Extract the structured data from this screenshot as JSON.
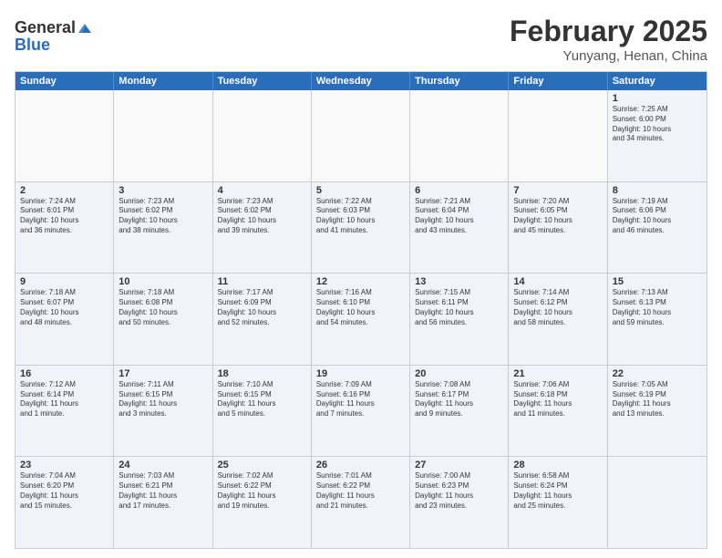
{
  "header": {
    "logo_general": "General",
    "logo_blue": "Blue",
    "month": "February 2025",
    "location": "Yunyang, Henan, China"
  },
  "weekdays": [
    "Sunday",
    "Monday",
    "Tuesday",
    "Wednesday",
    "Thursday",
    "Friday",
    "Saturday"
  ],
  "rows": [
    [
      {
        "day": "",
        "text": ""
      },
      {
        "day": "",
        "text": ""
      },
      {
        "day": "",
        "text": ""
      },
      {
        "day": "",
        "text": ""
      },
      {
        "day": "",
        "text": ""
      },
      {
        "day": "",
        "text": ""
      },
      {
        "day": "1",
        "text": "Sunrise: 7:25 AM\nSunset: 6:00 PM\nDaylight: 10 hours\nand 34 minutes."
      }
    ],
    [
      {
        "day": "2",
        "text": "Sunrise: 7:24 AM\nSunset: 6:01 PM\nDaylight: 10 hours\nand 36 minutes."
      },
      {
        "day": "3",
        "text": "Sunrise: 7:23 AM\nSunset: 6:02 PM\nDaylight: 10 hours\nand 38 minutes."
      },
      {
        "day": "4",
        "text": "Sunrise: 7:23 AM\nSunset: 6:02 PM\nDaylight: 10 hours\nand 39 minutes."
      },
      {
        "day": "5",
        "text": "Sunrise: 7:22 AM\nSunset: 6:03 PM\nDaylight: 10 hours\nand 41 minutes."
      },
      {
        "day": "6",
        "text": "Sunrise: 7:21 AM\nSunset: 6:04 PM\nDaylight: 10 hours\nand 43 minutes."
      },
      {
        "day": "7",
        "text": "Sunrise: 7:20 AM\nSunset: 6:05 PM\nDaylight: 10 hours\nand 45 minutes."
      },
      {
        "day": "8",
        "text": "Sunrise: 7:19 AM\nSunset: 6:06 PM\nDaylight: 10 hours\nand 46 minutes."
      }
    ],
    [
      {
        "day": "9",
        "text": "Sunrise: 7:18 AM\nSunset: 6:07 PM\nDaylight: 10 hours\nand 48 minutes."
      },
      {
        "day": "10",
        "text": "Sunrise: 7:18 AM\nSunset: 6:08 PM\nDaylight: 10 hours\nand 50 minutes."
      },
      {
        "day": "11",
        "text": "Sunrise: 7:17 AM\nSunset: 6:09 PM\nDaylight: 10 hours\nand 52 minutes."
      },
      {
        "day": "12",
        "text": "Sunrise: 7:16 AM\nSunset: 6:10 PM\nDaylight: 10 hours\nand 54 minutes."
      },
      {
        "day": "13",
        "text": "Sunrise: 7:15 AM\nSunset: 6:11 PM\nDaylight: 10 hours\nand 56 minutes."
      },
      {
        "day": "14",
        "text": "Sunrise: 7:14 AM\nSunset: 6:12 PM\nDaylight: 10 hours\nand 58 minutes."
      },
      {
        "day": "15",
        "text": "Sunrise: 7:13 AM\nSunset: 6:13 PM\nDaylight: 10 hours\nand 59 minutes."
      }
    ],
    [
      {
        "day": "16",
        "text": "Sunrise: 7:12 AM\nSunset: 6:14 PM\nDaylight: 11 hours\nand 1 minute."
      },
      {
        "day": "17",
        "text": "Sunrise: 7:11 AM\nSunset: 6:15 PM\nDaylight: 11 hours\nand 3 minutes."
      },
      {
        "day": "18",
        "text": "Sunrise: 7:10 AM\nSunset: 6:15 PM\nDaylight: 11 hours\nand 5 minutes."
      },
      {
        "day": "19",
        "text": "Sunrise: 7:09 AM\nSunset: 6:16 PM\nDaylight: 11 hours\nand 7 minutes."
      },
      {
        "day": "20",
        "text": "Sunrise: 7:08 AM\nSunset: 6:17 PM\nDaylight: 11 hours\nand 9 minutes."
      },
      {
        "day": "21",
        "text": "Sunrise: 7:06 AM\nSunset: 6:18 PM\nDaylight: 11 hours\nand 11 minutes."
      },
      {
        "day": "22",
        "text": "Sunrise: 7:05 AM\nSunset: 6:19 PM\nDaylight: 11 hours\nand 13 minutes."
      }
    ],
    [
      {
        "day": "23",
        "text": "Sunrise: 7:04 AM\nSunset: 6:20 PM\nDaylight: 11 hours\nand 15 minutes."
      },
      {
        "day": "24",
        "text": "Sunrise: 7:03 AM\nSunset: 6:21 PM\nDaylight: 11 hours\nand 17 minutes."
      },
      {
        "day": "25",
        "text": "Sunrise: 7:02 AM\nSunset: 6:22 PM\nDaylight: 11 hours\nand 19 minutes."
      },
      {
        "day": "26",
        "text": "Sunrise: 7:01 AM\nSunset: 6:22 PM\nDaylight: 11 hours\nand 21 minutes."
      },
      {
        "day": "27",
        "text": "Sunrise: 7:00 AM\nSunset: 6:23 PM\nDaylight: 11 hours\nand 23 minutes."
      },
      {
        "day": "28",
        "text": "Sunrise: 6:58 AM\nSunset: 6:24 PM\nDaylight: 11 hours\nand 25 minutes."
      },
      {
        "day": "",
        "text": ""
      }
    ]
  ]
}
